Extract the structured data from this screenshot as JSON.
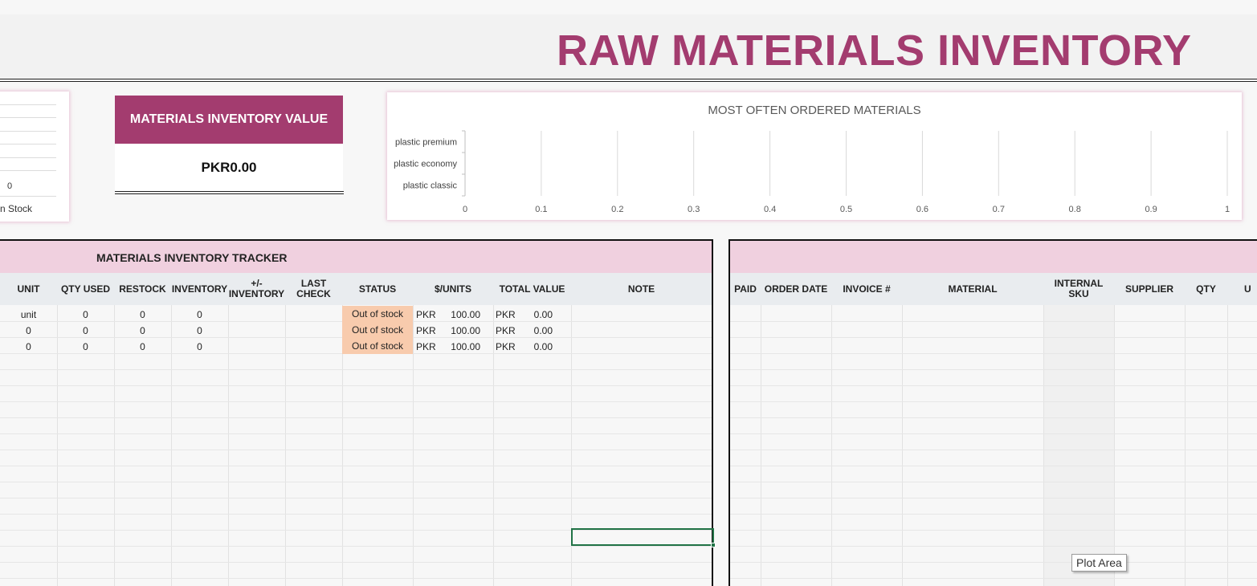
{
  "title": "RAW MATERIALS INVENTORY",
  "left_card": {
    "value": "0",
    "label": "n Stock"
  },
  "value_card": {
    "header": "MATERIALS INVENTORY VALUE",
    "value": "PKR0.00"
  },
  "chart_data": {
    "type": "bar",
    "orientation": "horizontal",
    "title": "MOST OFTEN ORDERED MATERIALS",
    "categories": [
      "plastic premium",
      "plastic economy",
      "plastic classic"
    ],
    "values": [
      0,
      0,
      0
    ],
    "xlim": [
      0,
      1
    ],
    "xticks": [
      "0",
      "0.1",
      "0.2",
      "0.3",
      "0.4",
      "0.5",
      "0.6",
      "0.7",
      "0.8",
      "0.9",
      "1"
    ],
    "grid": true,
    "legend": "none"
  },
  "tracker": {
    "title": "MATERIALS INVENTORY TRACKER",
    "headers": {
      "unit": "UNIT",
      "qty_used": "QTY USED",
      "restock": "RESTOCK",
      "inventory": "INVENTORY",
      "delta_line1": "+/-",
      "delta_line2": "INVENTORY",
      "last_check": "LAST CHECK",
      "status": "STATUS",
      "unit_price": "$/UNITS",
      "total_value": "TOTAL VALUE",
      "note": "NOTE"
    },
    "rows": [
      {
        "unit": "unit",
        "qty_used": "0",
        "restock": "0",
        "inventory": "0",
        "status": "Out of stock",
        "cur1": "PKR",
        "price": "100.00",
        "cur2": "PKR",
        "total": "0.00"
      },
      {
        "unit": "0",
        "qty_used": "0",
        "restock": "0",
        "inventory": "0",
        "status": "Out of stock",
        "cur1": "PKR",
        "price": "100.00",
        "cur2": "PKR",
        "total": "0.00"
      },
      {
        "unit": "0",
        "qty_used": "0",
        "restock": "0",
        "inventory": "0",
        "status": "Out of stock",
        "cur1": "PKR",
        "price": "100.00",
        "cur2": "PKR",
        "total": "0.00"
      }
    ]
  },
  "orders": {
    "headers": {
      "paid": "PAID",
      "order_date": "ORDER DATE",
      "invoice": "INVOICE #",
      "material": "MATERIAL",
      "internal_sku": "INTERNAL SKU",
      "supplier": "SUPPLIER",
      "qty": "QTY",
      "unit": "U"
    }
  },
  "tooltip": "Plot Area",
  "colors": {
    "accent": "#a33c6f",
    "band": "#f0d0df",
    "status_fill": "#f8cbad",
    "selection": "#217346"
  }
}
